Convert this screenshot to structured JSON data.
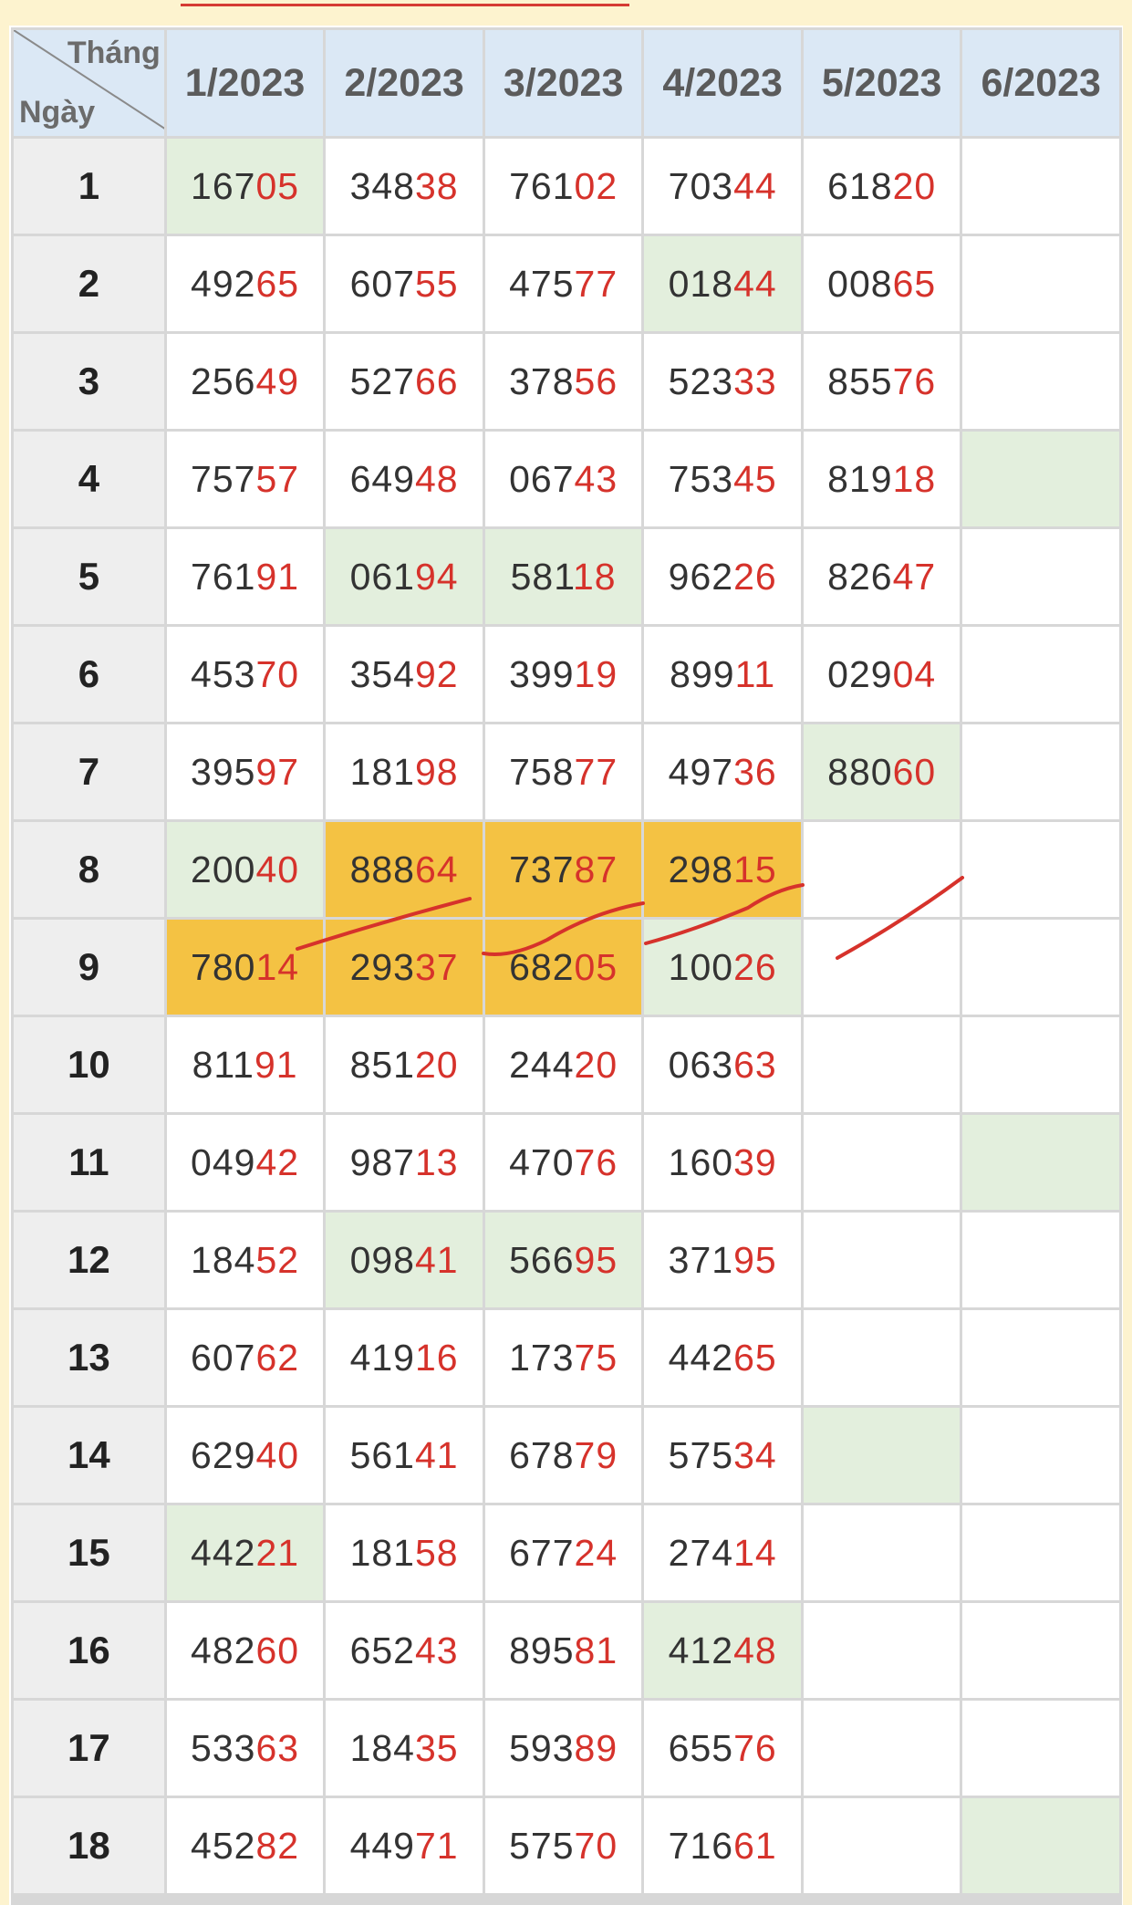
{
  "header": {
    "corner_top": "Tháng",
    "corner_bottom": "Ngày",
    "months": [
      "1/2023",
      "2/2023",
      "3/2023",
      "4/2023",
      "5/2023",
      "6/2023"
    ]
  },
  "colors": {
    "header_bg": "#dbe8f5",
    "green_highlight": "#e3efdd",
    "orange_highlight": "#f4c243",
    "red_digits": "#d6322b",
    "annotation_stroke": "#d6322b"
  },
  "rows": [
    {
      "day": "1",
      "cells": [
        {
          "v": "16705",
          "h": "g"
        },
        {
          "v": "34838"
        },
        {
          "v": "76102"
        },
        {
          "v": "70344"
        },
        {
          "v": "61820"
        },
        {
          "v": ""
        }
      ]
    },
    {
      "day": "2",
      "cells": [
        {
          "v": "49265"
        },
        {
          "v": "60755"
        },
        {
          "v": "47577"
        },
        {
          "v": "01844",
          "h": "g"
        },
        {
          "v": "00865"
        },
        {
          "v": ""
        }
      ]
    },
    {
      "day": "3",
      "cells": [
        {
          "v": "25649"
        },
        {
          "v": "52766"
        },
        {
          "v": "37856"
        },
        {
          "v": "52333"
        },
        {
          "v": "85576"
        },
        {
          "v": ""
        }
      ]
    },
    {
      "day": "4",
      "cells": [
        {
          "v": "75757"
        },
        {
          "v": "64948"
        },
        {
          "v": "06743"
        },
        {
          "v": "75345"
        },
        {
          "v": "81918"
        },
        {
          "v": "",
          "h": "g"
        }
      ]
    },
    {
      "day": "5",
      "cells": [
        {
          "v": "76191"
        },
        {
          "v": "06194",
          "h": "g"
        },
        {
          "v": "58118",
          "h": "g"
        },
        {
          "v": "96226"
        },
        {
          "v": "82647"
        },
        {
          "v": ""
        }
      ]
    },
    {
      "day": "6",
      "cells": [
        {
          "v": "45370"
        },
        {
          "v": "35492"
        },
        {
          "v": "39919"
        },
        {
          "v": "89911"
        },
        {
          "v": "02904"
        },
        {
          "v": ""
        }
      ]
    },
    {
      "day": "7",
      "cells": [
        {
          "v": "39597"
        },
        {
          "v": "18198"
        },
        {
          "v": "75877"
        },
        {
          "v": "49736"
        },
        {
          "v": "88060",
          "h": "g"
        },
        {
          "v": ""
        }
      ]
    },
    {
      "day": "8",
      "cells": [
        {
          "v": "20040",
          "h": "g"
        },
        {
          "v": "88864",
          "h": "o"
        },
        {
          "v": "73787",
          "h": "o"
        },
        {
          "v": "29815",
          "h": "o"
        },
        {
          "v": ""
        },
        {
          "v": ""
        }
      ]
    },
    {
      "day": "9",
      "cells": [
        {
          "v": "78014",
          "h": "o"
        },
        {
          "v": "29337",
          "h": "o"
        },
        {
          "v": "68205",
          "h": "o"
        },
        {
          "v": "10026",
          "h": "g"
        },
        {
          "v": ""
        },
        {
          "v": ""
        }
      ]
    },
    {
      "day": "10",
      "cells": [
        {
          "v": "81191"
        },
        {
          "v": "85120"
        },
        {
          "v": "24420"
        },
        {
          "v": "06363"
        },
        {
          "v": ""
        },
        {
          "v": ""
        }
      ]
    },
    {
      "day": "11",
      "cells": [
        {
          "v": "04942"
        },
        {
          "v": "98713"
        },
        {
          "v": "47076"
        },
        {
          "v": "16039"
        },
        {
          "v": ""
        },
        {
          "v": "",
          "h": "g"
        }
      ]
    },
    {
      "day": "12",
      "cells": [
        {
          "v": "18452"
        },
        {
          "v": "09841",
          "h": "g"
        },
        {
          "v": "56695",
          "h": "g"
        },
        {
          "v": "37195"
        },
        {
          "v": ""
        },
        {
          "v": ""
        }
      ]
    },
    {
      "day": "13",
      "cells": [
        {
          "v": "60762"
        },
        {
          "v": "41916"
        },
        {
          "v": "17375"
        },
        {
          "v": "44265"
        },
        {
          "v": ""
        },
        {
          "v": ""
        }
      ]
    },
    {
      "day": "14",
      "cells": [
        {
          "v": "62940"
        },
        {
          "v": "56141"
        },
        {
          "v": "67879"
        },
        {
          "v": "57534"
        },
        {
          "v": "",
          "h": "g"
        },
        {
          "v": ""
        }
      ]
    },
    {
      "day": "15",
      "cells": [
        {
          "v": "44221",
          "h": "g"
        },
        {
          "v": "18158"
        },
        {
          "v": "67724"
        },
        {
          "v": "27414"
        },
        {
          "v": ""
        },
        {
          "v": ""
        }
      ]
    },
    {
      "day": "16",
      "cells": [
        {
          "v": "48260"
        },
        {
          "v": "65243"
        },
        {
          "v": "89581"
        },
        {
          "v": "41248",
          "h": "g"
        },
        {
          "v": ""
        },
        {
          "v": ""
        }
      ]
    },
    {
      "day": "17",
      "cells": [
        {
          "v": "53363"
        },
        {
          "v": "18435"
        },
        {
          "v": "59389"
        },
        {
          "v": "65576"
        },
        {
          "v": ""
        },
        {
          "v": ""
        }
      ]
    },
    {
      "day": "18",
      "cells": [
        {
          "v": "45282"
        },
        {
          "v": "44971"
        },
        {
          "v": "57570"
        },
        {
          "v": "71661"
        },
        {
          "v": ""
        },
        {
          "v": "",
          "h": "g"
        }
      ]
    }
  ]
}
